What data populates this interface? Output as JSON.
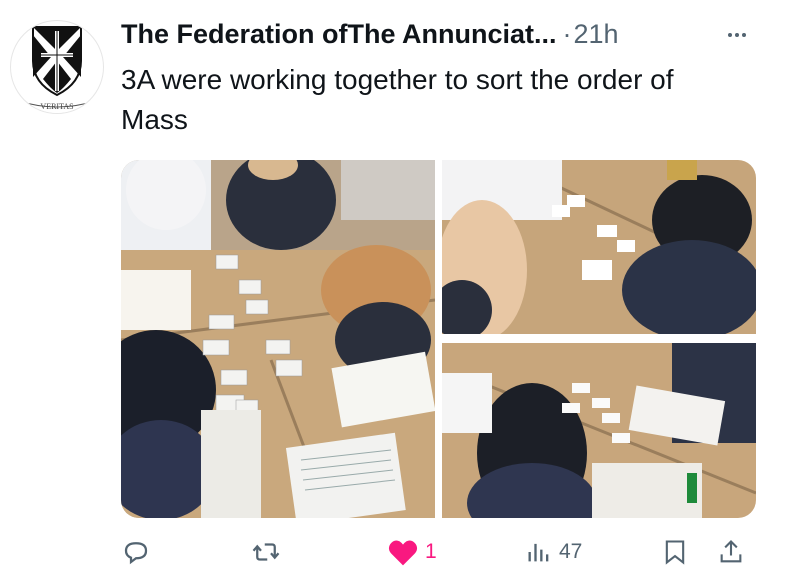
{
  "tweet": {
    "author": "The Federation ofThe Annunciat...",
    "separator": "·",
    "time": "21h",
    "text": "3A were working together to sort the order of Mass",
    "avatar_motto": "VERITAS"
  },
  "actions": {
    "reply_count": "",
    "retweet_count": "",
    "like_count": "1",
    "views_count": "47"
  },
  "colors": {
    "like": "#f91880",
    "secondary_text": "#536471",
    "primary_text": "#0f1419"
  },
  "icons": [
    "reply-icon",
    "retweet-icon",
    "like-icon",
    "views-icon",
    "bookmark-icon",
    "share-icon",
    "more-icon"
  ]
}
